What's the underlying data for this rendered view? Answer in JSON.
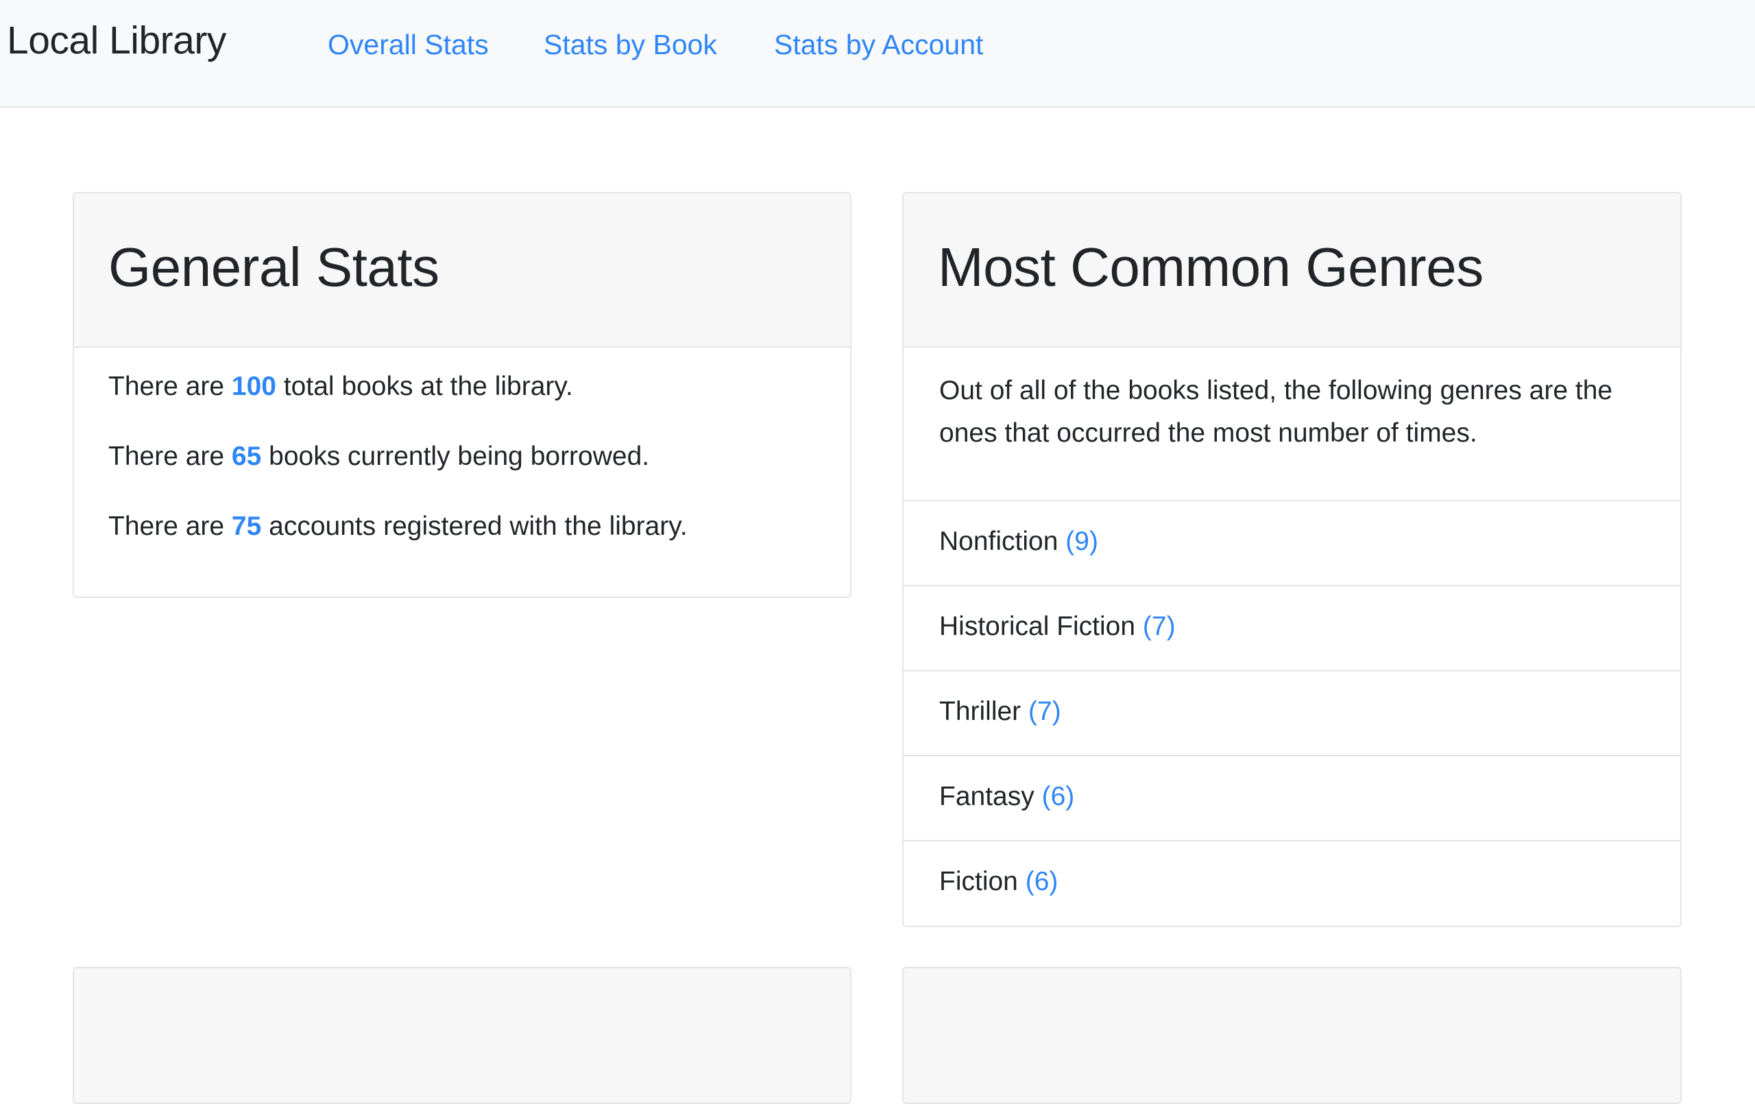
{
  "navbar": {
    "brand": "Local Library",
    "links": [
      "Overall Stats",
      "Stats by Book",
      "Stats by Account"
    ]
  },
  "general_stats": {
    "title": "General Stats",
    "lines": [
      {
        "prefix": "There are ",
        "value": "100",
        "suffix": " total books at the library."
      },
      {
        "prefix": "There are ",
        "value": "65",
        "suffix": " books currently being borrowed."
      },
      {
        "prefix": "There are ",
        "value": "75",
        "suffix": " accounts registered with the library."
      }
    ]
  },
  "genres": {
    "title": "Most Common Genres",
    "intro": "Out of all of the books listed, the following genres are the ones that occurred the most number of times.",
    "items": [
      {
        "name": "Nonfiction",
        "count": "(9)"
      },
      {
        "name": "Historical Fiction",
        "count": "(7)"
      },
      {
        "name": "Thriller",
        "count": "(7)"
      },
      {
        "name": "Fantasy",
        "count": "(6)"
      },
      {
        "name": "Fiction",
        "count": "(6)"
      }
    ]
  },
  "colors": {
    "accent": "#2f86f6",
    "navbar_bg": "#f8f9fa",
    "card_header_bg": "#f7f7f7",
    "text": "#212529"
  }
}
